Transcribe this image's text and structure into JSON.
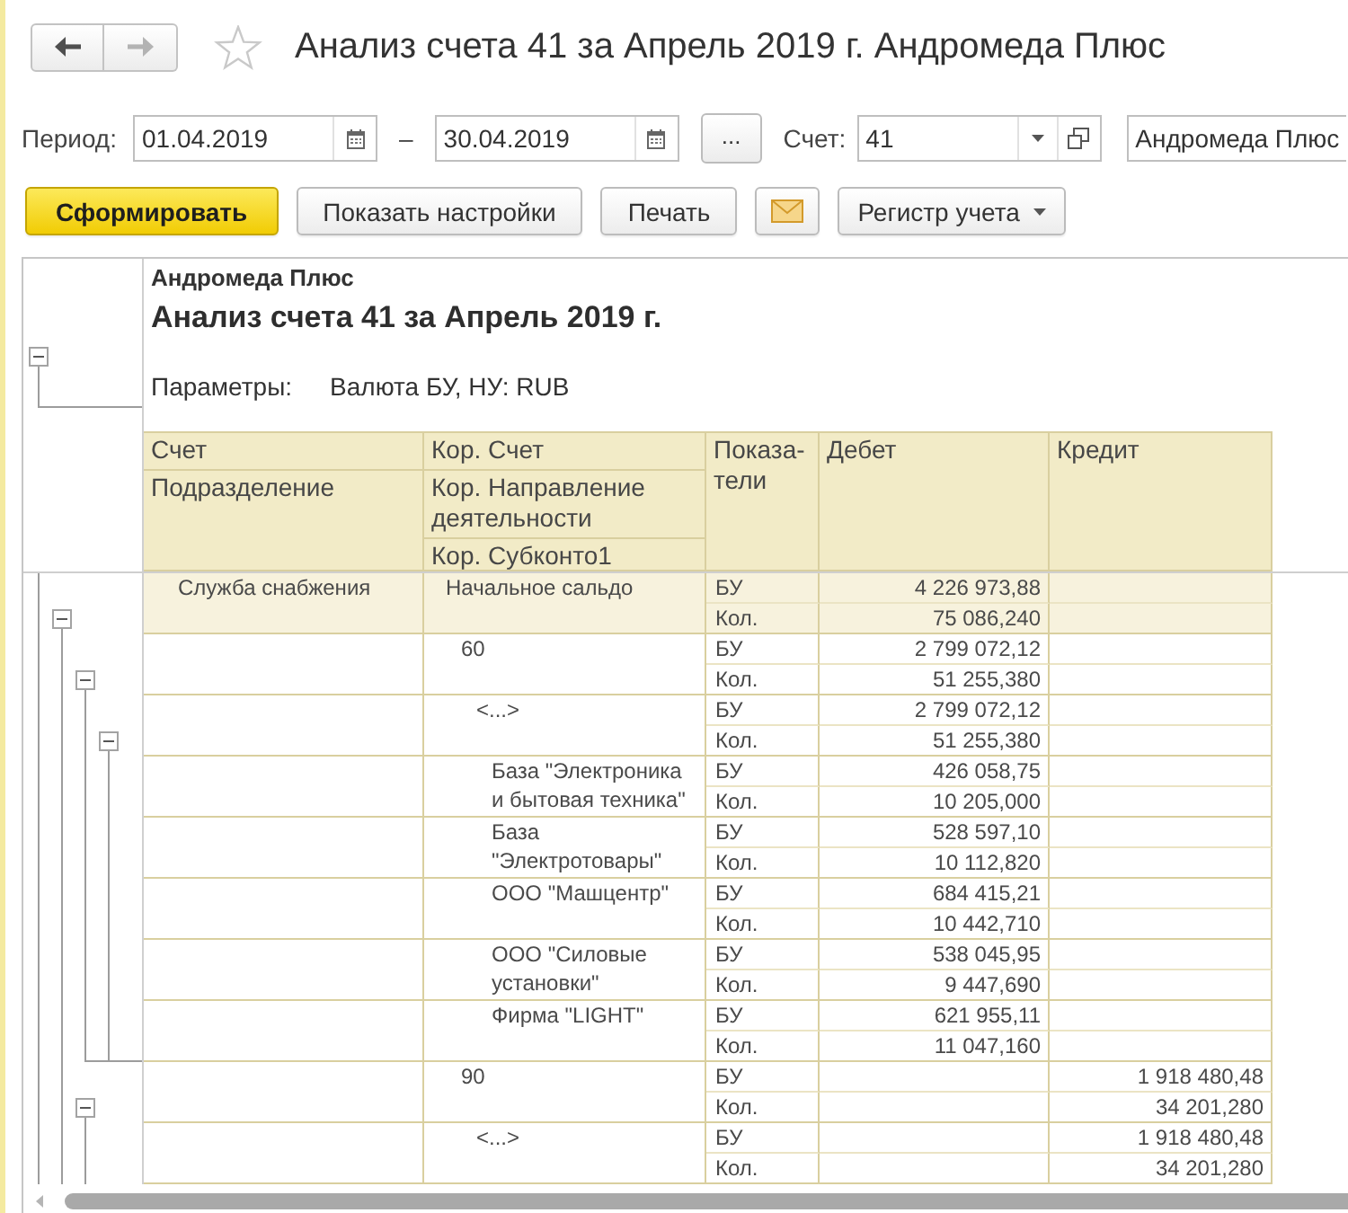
{
  "window": {
    "title": "Анализ счета 41 за Апрель 2019 г. Андромеда Плюс",
    "favorite": false
  },
  "nav": [
    {
      "kind": "back",
      "disabled": false
    },
    {
      "kind": "forward",
      "disabled": true
    }
  ],
  "filters": {
    "period_label": "Период:",
    "date_from": "01.04.2019",
    "range_dash": "–",
    "date_to": "30.04.2019",
    "more_button": "...",
    "account_label": "Счет:",
    "account": "41",
    "organization": "Андромеда Плюс"
  },
  "toolbar": [
    {
      "kind": "primary",
      "label": "Сформировать"
    },
    {
      "kind": "default",
      "label": "Показать настройки"
    },
    {
      "kind": "default",
      "label": "Печать"
    },
    {
      "kind": "mail"
    },
    {
      "kind": "dropdown",
      "label": "Регистр учета"
    }
  ],
  "report": {
    "header_expanded": true,
    "organization": "Андромеда Плюс",
    "title": "Анализ счета 41 за Апрель 2019 г.",
    "parameters_label": "Параметры:",
    "parameters_value": "Валюта БУ, НУ: RUB",
    "columns": [
      {
        "lines": [
          "Счет",
          "Подразделение"
        ]
      },
      {
        "lines": [
          "Кор. Счет",
          "Кор. Направление деятельности",
          "Кор. Субконто1"
        ]
      },
      {
        "lines": [
          "Показа-тели"
        ]
      },
      {
        "lines": [
          "Дебет"
        ]
      },
      {
        "lines": [
          "Кредит"
        ]
      }
    ],
    "rows": [
      {
        "division": "Служба снабжения",
        "label": "Начальное сальдо",
        "expanded": true,
        "lines": [
          {
            "indicator": "БУ",
            "debit": "4 226 973,88"
          },
          {
            "indicator": "Кол.",
            "debit": "75 086,240"
          }
        ],
        "children": [
          {
            "label": "60",
            "expanded": true,
            "lines": [
              {
                "indicator": "БУ",
                "debit": "2 799 072,12"
              },
              {
                "indicator": "Кол.",
                "debit": "51 255,380"
              }
            ],
            "children": [
              {
                "label": "<...>",
                "expanded": true,
                "lines": [
                  {
                    "indicator": "БУ",
                    "debit": "2 799 072,12"
                  },
                  {
                    "indicator": "Кол.",
                    "debit": "51 255,380"
                  }
                ],
                "children": [
                  {
                    "label": "База \"Электроника и бытовая техника\"",
                    "lines": [
                      {
                        "indicator": "БУ",
                        "debit": "426 058,75"
                      },
                      {
                        "indicator": "Кол.",
                        "debit": "10 205,000"
                      }
                    ]
                  },
                  {
                    "label": "База \"Электротовары\"",
                    "lines": [
                      {
                        "indicator": "БУ",
                        "debit": "528 597,10"
                      },
                      {
                        "indicator": "Кол.",
                        "debit": "10 112,820"
                      }
                    ]
                  },
                  {
                    "label": "ООО \"Машцентр\"",
                    "lines": [
                      {
                        "indicator": "БУ",
                        "debit": "684 415,21"
                      },
                      {
                        "indicator": "Кол.",
                        "debit": "10 442,710"
                      }
                    ]
                  },
                  {
                    "label": "ООО \"Силовые установки\"",
                    "lines": [
                      {
                        "indicator": "БУ",
                        "debit": "538 045,95"
                      },
                      {
                        "indicator": "Кол.",
                        "debit": "9 447,690"
                      }
                    ]
                  },
                  {
                    "label": "Фирма \"LIGHT\"",
                    "lines": [
                      {
                        "indicator": "БУ",
                        "debit": "621 955,11"
                      },
                      {
                        "indicator": "Кол.",
                        "debit": "11 047,160"
                      }
                    ]
                  }
                ]
              }
            ]
          },
          {
            "label": "90",
            "expanded": true,
            "lines": [
              {
                "indicator": "БУ",
                "credit": "1 918 480,48"
              },
              {
                "indicator": "Кол.",
                "credit": "34 201,280"
              }
            ],
            "children": [
              {
                "label": "<...>",
                "lines": [
                  {
                    "indicator": "БУ",
                    "credit": "1 918 480,48"
                  },
                  {
                    "indicator": "Кол.",
                    "credit": "34 201,280"
                  }
                ]
              }
            ]
          }
        ]
      }
    ]
  }
}
